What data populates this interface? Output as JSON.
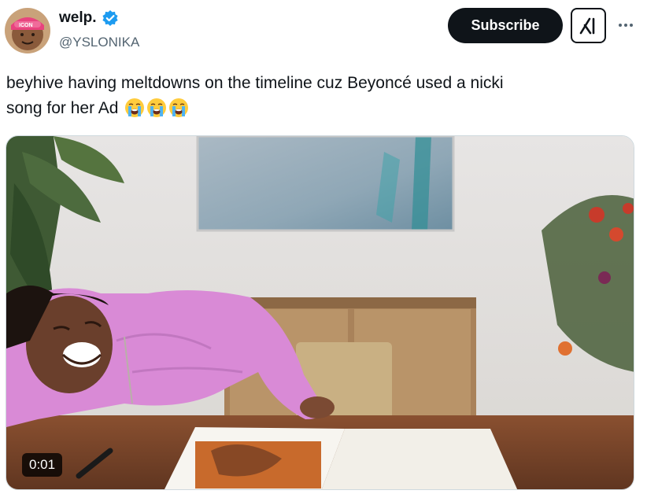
{
  "author": {
    "display_name": "welp.",
    "handle": "@YSLONIKA",
    "avatar_text": "ICON"
  },
  "actions": {
    "subscribe_label": "Subscribe",
    "grok_icon": "grok-icon",
    "more_icon": "more-icon"
  },
  "tweet": {
    "text_line1": "beyhive having meltdowns on the timeline cuz Beyoncé used a nicki",
    "text_line2": "song for her Ad",
    "emoji_name": "loudly-crying-face",
    "emoji_count": 3
  },
  "media": {
    "type": "video",
    "timestamp": "0:01"
  },
  "colors": {
    "accent": "#0f1419",
    "verified": "#1d9bf0",
    "handle": "#536471"
  }
}
